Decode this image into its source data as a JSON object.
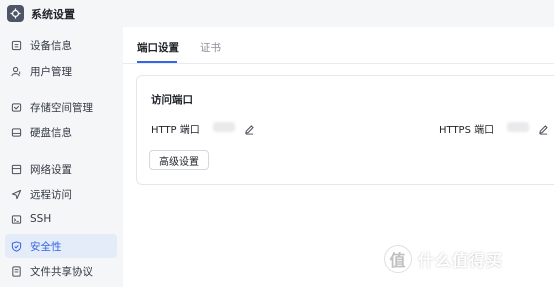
{
  "app": {
    "title": "系统设置"
  },
  "sidebar": {
    "items": [
      {
        "label": "设备信息",
        "icon": "device-info-icon",
        "active": false
      },
      {
        "label": "用户管理",
        "icon": "user-icon",
        "active": false
      },
      {
        "label": "存储空间管理",
        "icon": "storage-icon",
        "active": false
      },
      {
        "label": "硬盘信息",
        "icon": "disk-icon",
        "active": false
      },
      {
        "label": "网络设置",
        "icon": "network-icon",
        "active": false
      },
      {
        "label": "远程访问",
        "icon": "remote-access-icon",
        "active": false
      },
      {
        "label": "SSH",
        "icon": "terminal-icon",
        "active": false
      },
      {
        "label": "安全性",
        "icon": "shield-icon",
        "active": true
      },
      {
        "label": "文件共享协议",
        "icon": "file-share-icon",
        "active": false
      }
    ]
  },
  "tabs": [
    {
      "label": "端口设置",
      "active": true
    },
    {
      "label": "证书",
      "active": false
    }
  ],
  "card": {
    "title": "访问端口",
    "http_label": "HTTP 端口",
    "https_label": "HTTPS 端口",
    "advanced_button": "高级设置"
  },
  "watermark": {
    "text": "什么值得买",
    "badge": "值"
  },
  "colors": {
    "accent": "#3366e6",
    "active_bg": "#e4ebf9",
    "sidebar_bg": "#f5f6f8"
  }
}
